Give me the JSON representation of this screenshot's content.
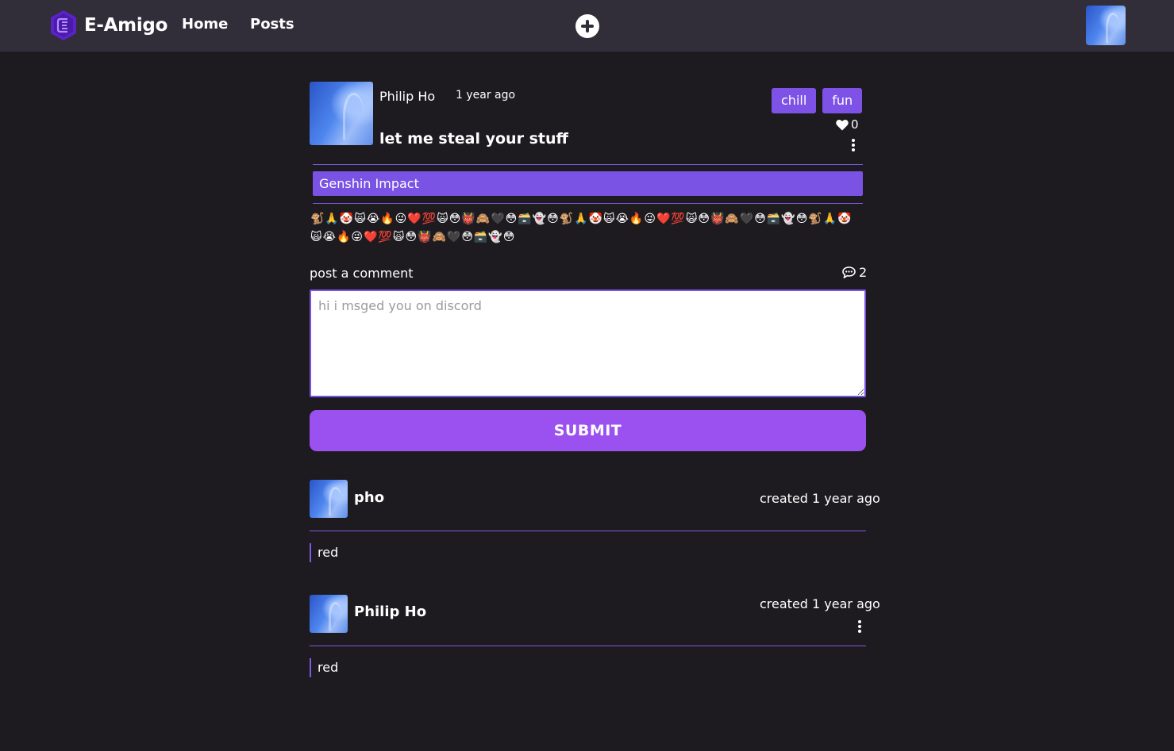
{
  "nav": {
    "brand": "E-Amigo",
    "links": [
      "Home",
      "Posts"
    ]
  },
  "post": {
    "author": "Philip Ho",
    "time": "1 year ago",
    "title": "let me steal your stuff",
    "tags": [
      "chill",
      "fun"
    ],
    "likes": "0",
    "game": "Genshin Impact",
    "emojis": "🐒🙏🤡🙀😭🔥😜❤️💯🙀😳👹🙈🖤😳🗃️👻😳🐒🙏🤡🙀😭🔥😜❤️💯🙀😳👹🙈🖤😳🗃️👻😳🐒🙏🤡🙀😭🔥😜❤️💯🙀😳👹🙈🖤😳🗃️👻😳"
  },
  "comment_form": {
    "label": "post a comment",
    "count": "2",
    "placeholder": "hi i msged you on discord",
    "submit": "SUBMIT"
  },
  "comments": [
    {
      "author": "pho",
      "created": "created 1 year ago",
      "body": "red"
    },
    {
      "author": "Philip Ho",
      "created": "created 1 year ago",
      "body": "red"
    }
  ],
  "colors": {
    "background": "#1d1b20",
    "navbar": "#312e3a",
    "accent": "#7e52e6",
    "button": "#9b51f0"
  }
}
